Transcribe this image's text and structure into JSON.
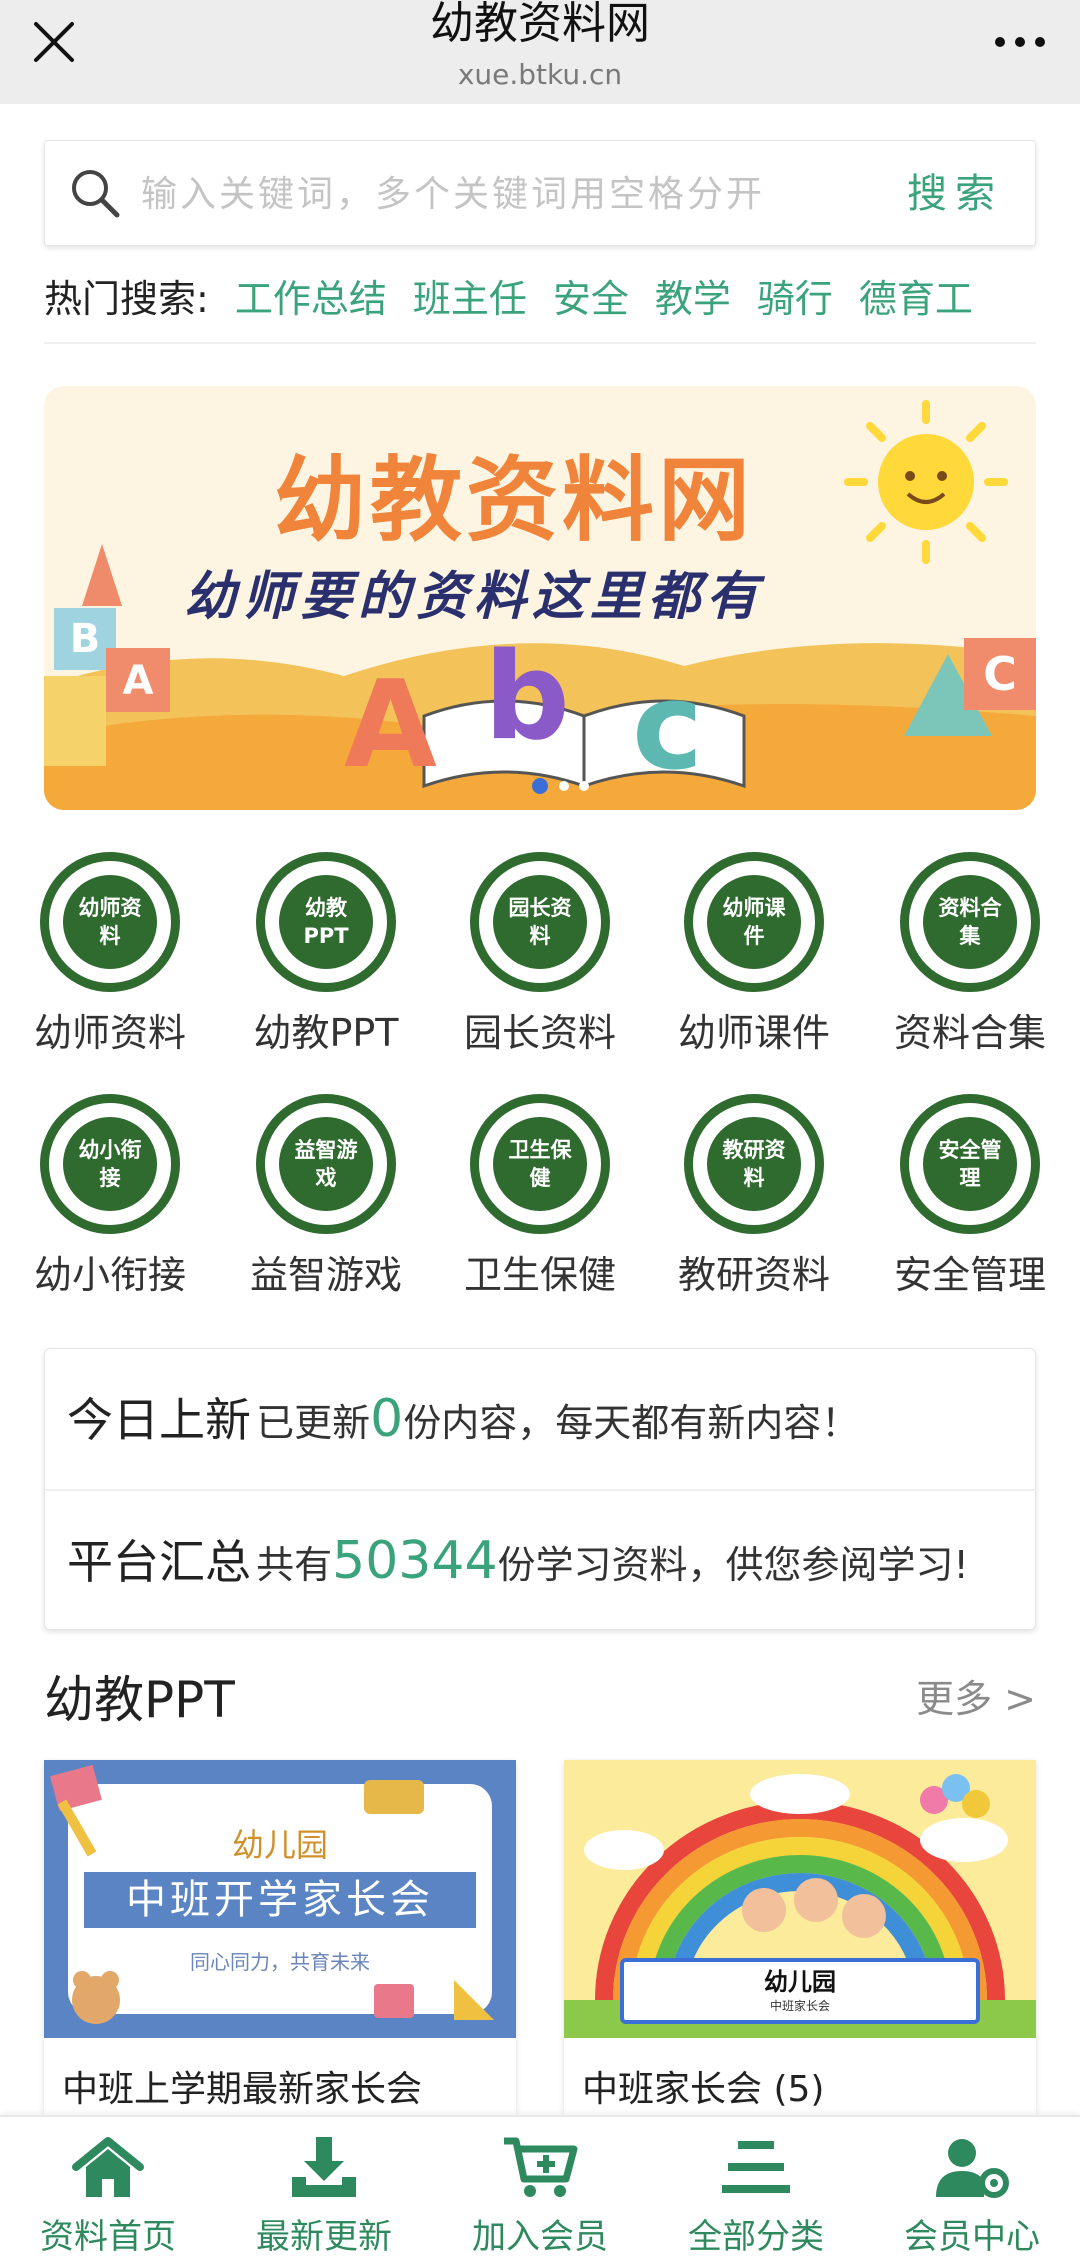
{
  "topbar": {
    "title": "幼教资料网",
    "url": "xue.btku.cn"
  },
  "search": {
    "placeholder": "输入关键词，多个关键词用空格分开",
    "button": "搜索"
  },
  "hot": {
    "label": "热门搜索:",
    "tags": [
      "工作总结",
      "班主任",
      "安全",
      "教学",
      "骑行",
      "德育工"
    ]
  },
  "banner": {
    "title": "幼教资料网",
    "subtitle": "幼师要的资料这里都有",
    "block_letters": [
      "B",
      "A",
      "C"
    ]
  },
  "categories": [
    {
      "icon": "幼师资料",
      "label": "幼师资料"
    },
    {
      "icon": "幼教PPT",
      "label": "幼教PPT"
    },
    {
      "icon": "园长资料",
      "label": "园长资料"
    },
    {
      "icon": "幼师课件",
      "label": "幼师课件"
    },
    {
      "icon": "资料合集",
      "label": "资料合集"
    },
    {
      "icon": "幼小衔接",
      "label": "幼小衔接"
    },
    {
      "icon": "益智游戏",
      "label": "益智游戏"
    },
    {
      "icon": "卫生保健",
      "label": "卫生保健"
    },
    {
      "icon": "教研资料",
      "label": "教研资料"
    },
    {
      "icon": "安全管理",
      "label": "安全管理"
    }
  ],
  "stats": {
    "today_head": "今日上新",
    "today_pre": "已更新",
    "today_num": "0",
    "today_post": "份内容，每天都有新内容！",
    "total_head": "平台汇总",
    "total_pre": "共有",
    "total_num": "50344",
    "total_post": "份学习资料，供您参阅学习!"
  },
  "section": {
    "title": "幼教PPT",
    "more": "更多 >"
  },
  "cards": [
    {
      "title": "中班上学期最新家长会",
      "thumb_line1": "幼儿园",
      "thumb_line2": "中班开学家长会",
      "thumb_line3": "同心同力，共育未来"
    },
    {
      "title": "中班家长会 (5)",
      "thumb_line1": "幼儿园",
      "thumb_line2": "中班家长会"
    }
  ],
  "tabbar": [
    {
      "icon": "home-icon",
      "label": "资料首页"
    },
    {
      "icon": "download-icon",
      "label": "最新更新"
    },
    {
      "icon": "cart-icon",
      "label": "加入会员"
    },
    {
      "icon": "menu-list-icon",
      "label": "全部分类"
    },
    {
      "icon": "user-settings-icon",
      "label": "会员中心"
    }
  ],
  "colors": {
    "accent": "#3aa37c",
    "category_green": "#2f6a2f",
    "banner_orange": "#f0843a",
    "tab_green": "#2e8a5e"
  }
}
